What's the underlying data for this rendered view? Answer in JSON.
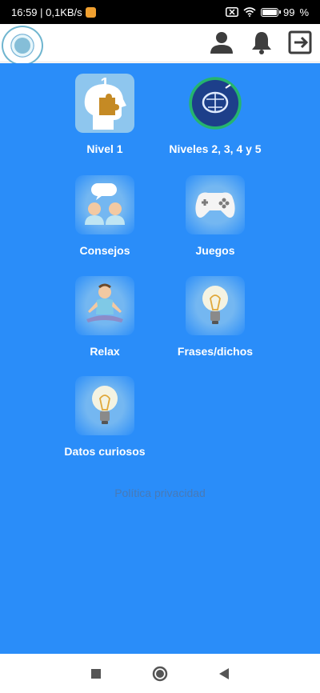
{
  "status_bar": {
    "time_speed": "16:59 | 0,1KB/s",
    "battery": "99"
  },
  "app_bar": {
    "icons": [
      "app-logo",
      "profile-icon",
      "bell-icon",
      "logout-icon"
    ]
  },
  "tiles": [
    {
      "label": "Nivel 1",
      "icon": "head-puzzle-icon",
      "badge": "1"
    },
    {
      "label": "Niveles 2, 3, 4 y 5",
      "icon": "brain-progress-icon"
    },
    {
      "label": "Consejos",
      "icon": "chat-people-icon"
    },
    {
      "label": "Juegos",
      "icon": "gamepad-icon"
    },
    {
      "label": "Relax",
      "icon": "meditation-icon"
    },
    {
      "label": "Frases/dichos",
      "icon": "lightbulb-icon"
    },
    {
      "label": "Datos curiosos",
      "icon": "lightbulb-icon"
    }
  ],
  "privacy": {
    "label": "Política privacidad"
  },
  "colors": {
    "background": "#2a8df9",
    "label": "#ffffff",
    "privacy": "#4b78b0"
  }
}
